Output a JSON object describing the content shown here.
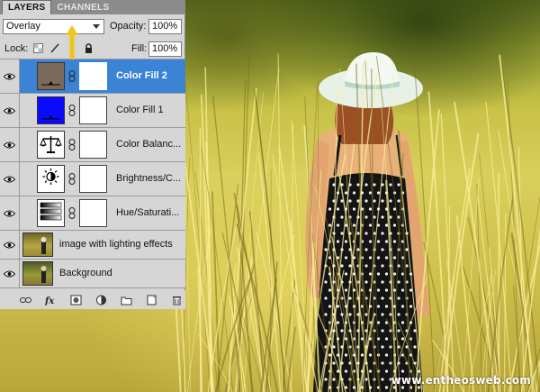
{
  "panel": {
    "tabs": [
      {
        "label": "LAYERS",
        "active": true
      },
      {
        "label": "CHANNELS",
        "active": false
      }
    ],
    "blend_mode": "Overlay",
    "opacity_label": "Opacity:",
    "opacity_value": "100%",
    "lock_label": "Lock:",
    "fill_label": "Fill:",
    "fill_value": "100%",
    "layers": [
      {
        "name": "Color Fill 2",
        "kind": "color-fill",
        "swatch": "#7a6a5c",
        "selected": true
      },
      {
        "name": "Color Fill 1",
        "kind": "color-fill",
        "swatch": "#0a0aff",
        "selected": false
      },
      {
        "name": "Color Balanc...",
        "kind": "adjustment",
        "icon": "scales-icon",
        "selected": false
      },
      {
        "name": "Brightness/C...",
        "kind": "adjustment",
        "icon": "sun-icon",
        "selected": false
      },
      {
        "name": "Hue/Saturati...",
        "kind": "adjustment",
        "icon": "gradient-bars-icon",
        "selected": false
      },
      {
        "name": "image with lighting effects",
        "kind": "image",
        "selected": false
      },
      {
        "name": "Background",
        "kind": "image",
        "selected": false
      }
    ],
    "bottom_icons": [
      "link-icon",
      "fx-icon",
      "mask-icon",
      "adjustment-icon",
      "folder-icon",
      "new-layer-icon",
      "trash-icon"
    ]
  },
  "watermark": "www.entheosweb.com",
  "colors": {
    "panel_bg": "#d6d6d6",
    "selection": "#3b83d5",
    "annotation_arrow": "#f0c419"
  }
}
